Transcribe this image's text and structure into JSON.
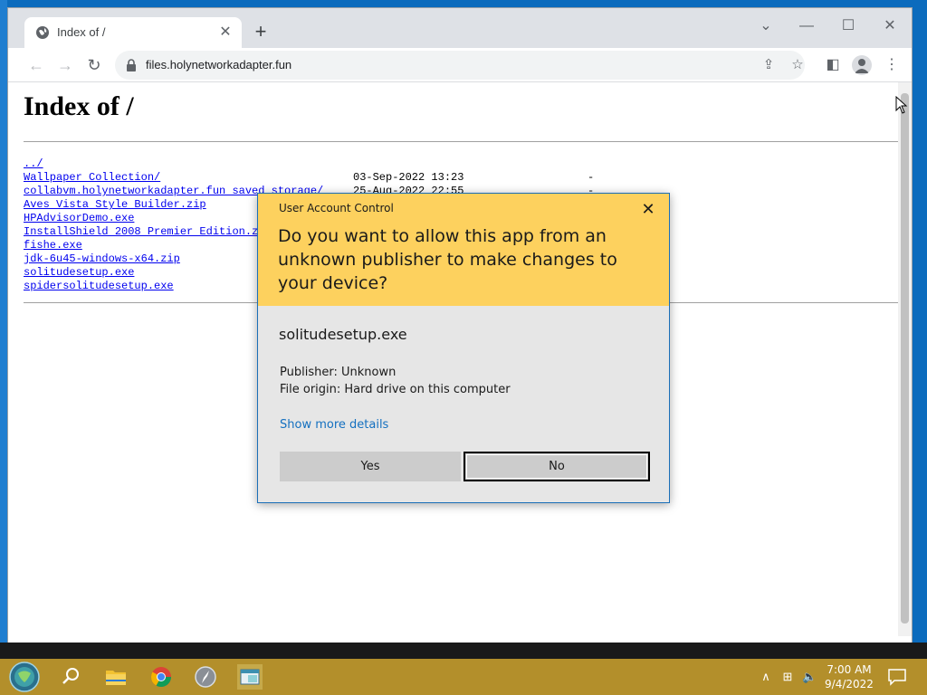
{
  "browser": {
    "tab_title": "Index of /",
    "url": "files.holynetworkadapter.fun"
  },
  "page": {
    "heading": "Index of /",
    "entries": [
      {
        "name": "../",
        "date": "",
        "size": ""
      },
      {
        "name": "Wallpaper Collection/",
        "date": "03-Sep-2022 13:23",
        "size": "-"
      },
      {
        "name": "collabvm.holynetworkadapter.fun saved storage/",
        "date": "25-Aug-2022 22:55",
        "size": "-"
      },
      {
        "name": "Aves Vista Style Builder.zip",
        "date": "",
        "size": ""
      },
      {
        "name": "HPAdvisorDemo.exe",
        "date": "",
        "size": ""
      },
      {
        "name": "InstallShield 2008 Premier Edition.z",
        "date": "",
        "size": ""
      },
      {
        "name": "fishe.exe",
        "date": "",
        "size": ""
      },
      {
        "name": "jdk-6u45-windows-x64.zip",
        "date": "",
        "size": ""
      },
      {
        "name": "solitudesetup.exe",
        "date": "",
        "size": ""
      },
      {
        "name": "spidersolitudesetup.exe",
        "date": "",
        "size": ""
      }
    ]
  },
  "uac": {
    "title": "User Account Control",
    "question": "Do you want to allow this app from an unknown publisher to make changes to your device?",
    "program": "solitudesetup.exe",
    "publisher": "Publisher: Unknown",
    "origin": "File origin: Hard drive on this computer",
    "more_details": "Show more details",
    "yes_label": "Yes",
    "no_label": "No"
  },
  "taskbar": {
    "time": "7:00 AM",
    "date": "9/4/2022"
  },
  "colors": {
    "uac_header": "#fdd15e",
    "taskbar": "#b38f2b",
    "link": "#0000ee"
  }
}
